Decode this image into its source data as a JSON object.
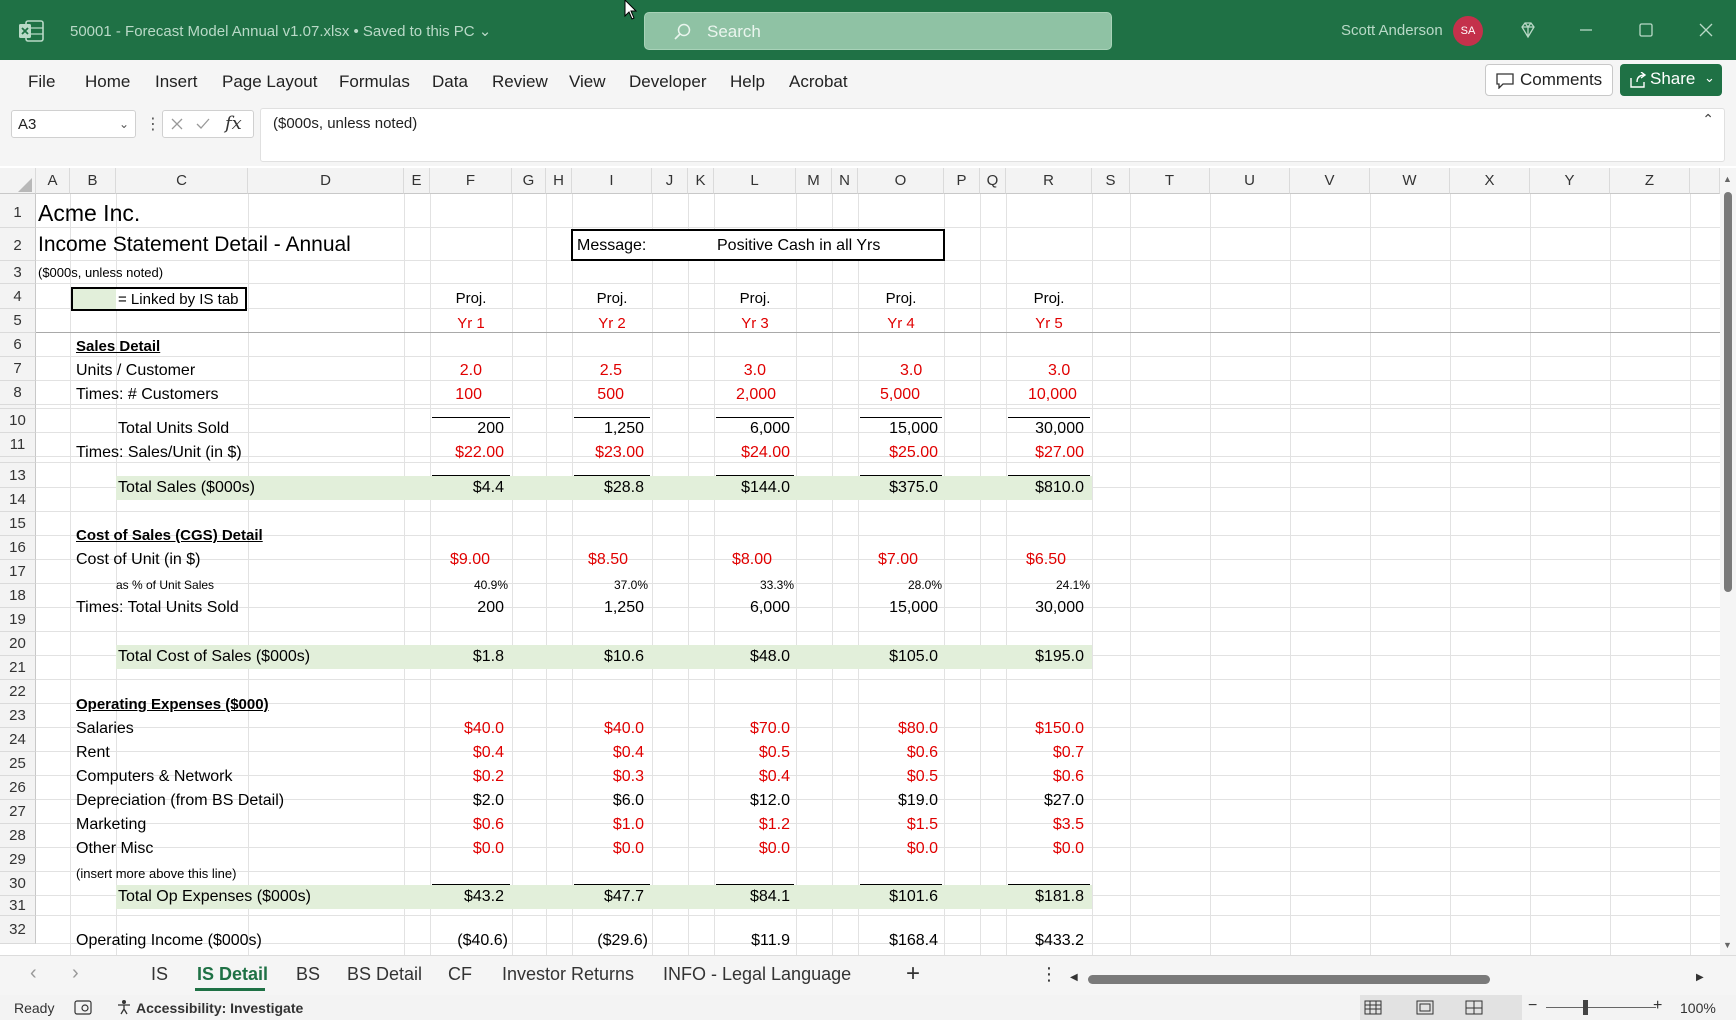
{
  "titlebar": {
    "doc_title": "50001 - Forecast Model Annual v1.07.xlsx  •  Saved to this PC ⌄",
    "search_placeholder": "Search",
    "user_name": "Scott Anderson",
    "user_initials": "SA"
  },
  "ribbon": {
    "menu": [
      "File",
      "Home",
      "Insert",
      "Page Layout",
      "Formulas",
      "Data",
      "Review",
      "View",
      "Developer",
      "Help",
      "Acrobat"
    ],
    "comments_label": "Comments",
    "share_label": "Share"
  },
  "formula_bar": {
    "name_box": "A3",
    "formula": "($000s, unless noted)"
  },
  "columns": [
    "A",
    "B",
    "C",
    "D",
    "E",
    "F",
    "G",
    "H",
    "I",
    "J",
    "K",
    "L",
    "M",
    "N",
    "O",
    "P",
    "Q",
    "R",
    "S",
    "T",
    "U",
    "V",
    "W",
    "X",
    "Y",
    "Z"
  ],
  "rows": [
    "1",
    "2",
    "3",
    "4",
    "5",
    "6",
    "7",
    "8",
    "10",
    "11",
    "13",
    "14",
    "15",
    "16",
    "17",
    "18",
    "19",
    "20",
    "21",
    "22",
    "23",
    "24",
    "25",
    "26",
    "27",
    "28",
    "29",
    "30",
    "31",
    "32"
  ],
  "sheet": {
    "company": "Acme Inc.",
    "title": "Income Statement Detail - Annual",
    "units_note": "($000s, unless noted)",
    "legend": "= Linked by IS tab",
    "message_label": "Message:",
    "message_value": "Positive Cash in all Yrs",
    "proj_label": "Proj.",
    "years": [
      "Yr 1",
      "Yr 2",
      "Yr 3",
      "Yr 4",
      "Yr 5"
    ],
    "sales_header": "Sales Detail",
    "units_customer": {
      "label": "Units / Customer",
      "values": [
        "2.0",
        "2.5",
        "3.0",
        "3.0",
        "3.0"
      ]
    },
    "customers": {
      "label": "Times:  # Customers",
      "values": [
        "100",
        "500",
        "2,000",
        "5,000",
        "10,000"
      ]
    },
    "total_units": {
      "label": "Total Units Sold",
      "values": [
        "200",
        "1,250",
        "6,000",
        "15,000",
        "30,000"
      ]
    },
    "sales_unit": {
      "label": "Times:  Sales/Unit (in $)",
      "values": [
        "$22.00",
        "$23.00",
        "$24.00",
        "$25.00",
        "$27.00"
      ]
    },
    "total_sales": {
      "label": "Total Sales ($000s)",
      "values": [
        "$4.4",
        "$28.8",
        "$144.0",
        "$375.0",
        "$810.0"
      ]
    },
    "cgs_header": "Cost of Sales (CGS) Detail",
    "cost_unit": {
      "label": "Cost of Unit (in $)",
      "values": [
        "$9.00",
        "$8.50",
        "$8.00",
        "$7.00",
        "$6.50"
      ]
    },
    "pct_sales": {
      "label": "as % of Unit Sales",
      "values": [
        "40.9%",
        "37.0%",
        "33.3%",
        "28.0%",
        "24.1%"
      ]
    },
    "times_units": {
      "label": "Times: Total Units Sold",
      "values": [
        "200",
        "1,250",
        "6,000",
        "15,000",
        "30,000"
      ]
    },
    "total_cgs": {
      "label": "Total Cost of Sales ($000s)",
      "values": [
        "$1.8",
        "$10.6",
        "$48.0",
        "$105.0",
        "$195.0"
      ]
    },
    "opex_header": "Operating Expenses ($000)",
    "salaries": {
      "label": "Salaries",
      "values": [
        "$40.0",
        "$40.0",
        "$70.0",
        "$80.0",
        "$150.0"
      ]
    },
    "rent": {
      "label": "Rent",
      "values": [
        "$0.4",
        "$0.4",
        "$0.5",
        "$0.6",
        "$0.7"
      ]
    },
    "computers": {
      "label": "Computers & Network",
      "values": [
        "$0.2",
        "$0.3",
        "$0.4",
        "$0.5",
        "$0.6"
      ]
    },
    "depreciation": {
      "label": "Depreciation (from BS Detail)",
      "values": [
        "$2.0",
        "$6.0",
        "$12.0",
        "$19.0",
        "$27.0"
      ]
    },
    "marketing": {
      "label": "Marketing",
      "values": [
        "$0.6",
        "$1.0",
        "$1.2",
        "$1.5",
        "$3.5"
      ]
    },
    "other": {
      "label": "Other Misc",
      "values": [
        "$0.0",
        "$0.0",
        "$0.0",
        "$0.0",
        "$0.0"
      ]
    },
    "insert_note": "(insert more above this line)",
    "total_opex": {
      "label": "Total Op Expenses ($000s)",
      "values": [
        "$43.2",
        "$47.7",
        "$84.1",
        "$101.6",
        "$181.8"
      ]
    },
    "op_income": {
      "label": "Operating Income ($000s)",
      "values": [
        "($40.6)",
        "($29.6)",
        "$11.9",
        "$168.4",
        "$433.2"
      ]
    }
  },
  "tabs": [
    "IS",
    "IS Detail",
    "BS",
    "BS Detail",
    "CF",
    "Investor Returns",
    "INFO - Legal Language"
  ],
  "active_tab": "IS Detail",
  "statusbar": {
    "ready": "Ready",
    "accessibility": "Accessibility: Investigate",
    "zoom": "100%"
  },
  "colors": {
    "excel_green": "#1f7145",
    "input_red": "#e00000",
    "linked_green": "#e2efda"
  }
}
